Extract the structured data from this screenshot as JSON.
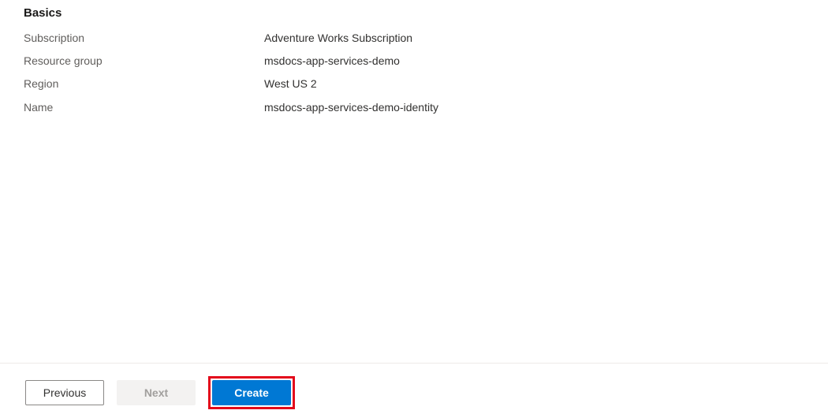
{
  "section": {
    "title": "Basics",
    "rows": [
      {
        "label": "Subscription",
        "value": "Adventure Works Subscription"
      },
      {
        "label": "Resource group",
        "value": "msdocs-app-services-demo"
      },
      {
        "label": "Region",
        "value": "West US 2"
      },
      {
        "label": "Name",
        "value": "msdocs-app-services-demo-identity"
      }
    ]
  },
  "footer": {
    "previous": "Previous",
    "next": "Next",
    "create": "Create"
  }
}
